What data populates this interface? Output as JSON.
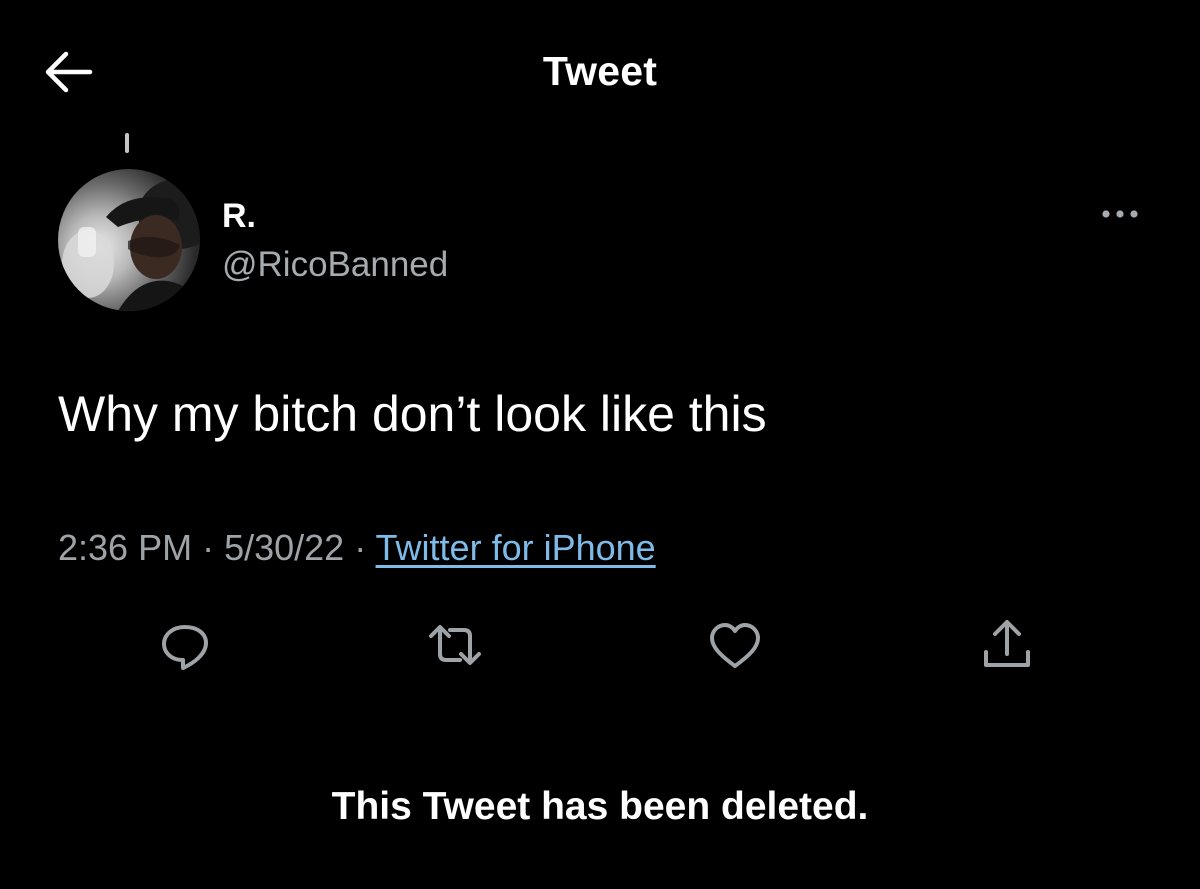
{
  "header": {
    "back_icon": "arrow-left-icon",
    "title": "Tweet"
  },
  "tweet": {
    "author_name": "R.",
    "author_handle": "@RicoBanned",
    "more_icon": "more-horizontal-icon",
    "text": "Why my bitch don’t look like this",
    "time": "2:36 PM",
    "separator": " · ",
    "date": "5/30/22",
    "source": "Twitter for iPhone"
  },
  "actions": {
    "reply_icon": "reply-icon",
    "retweet_icon": "retweet-icon",
    "like_icon": "heart-icon",
    "share_icon": "share-icon"
  },
  "notice": {
    "deleted": "This Tweet has been deleted."
  },
  "colors": {
    "background": "#000000",
    "text_primary": "#ffffff",
    "text_secondary": "#9ea3a8",
    "link": "#7fbbe8"
  }
}
